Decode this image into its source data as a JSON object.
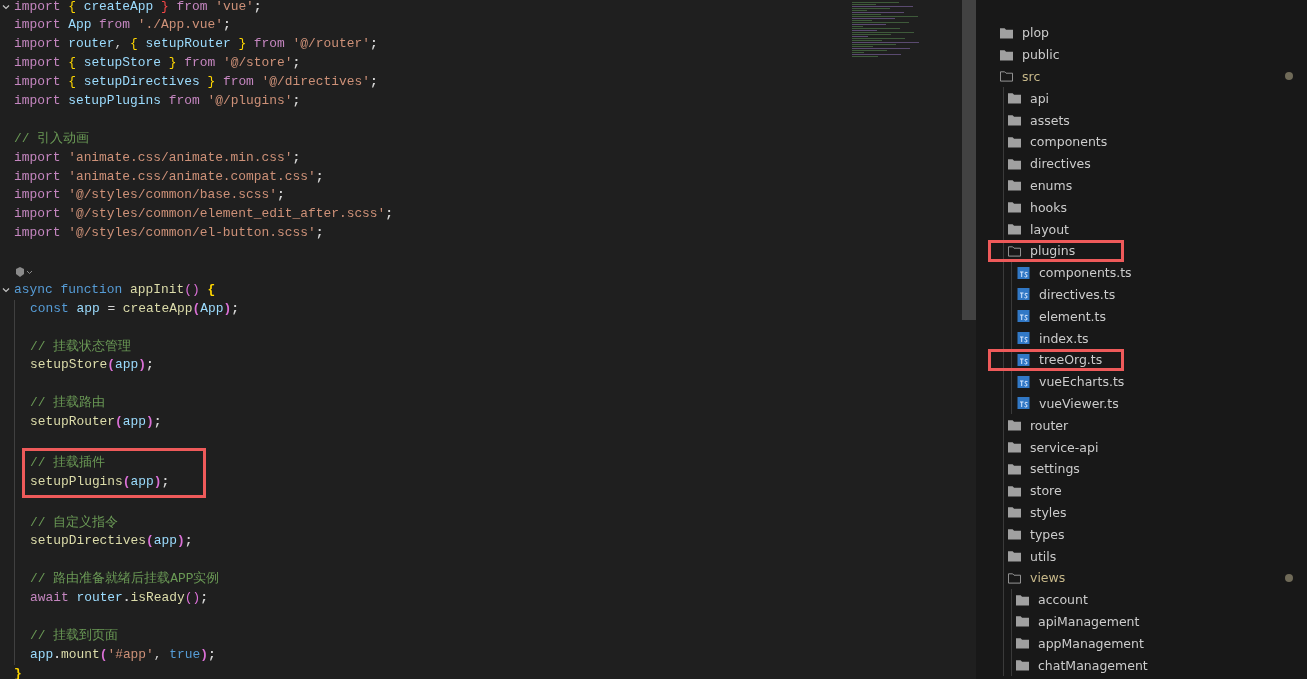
{
  "editor": {
    "lines": [
      {
        "kind": "code",
        "fold": true,
        "tokens": [
          {
            "t": "import ",
            "color": "#c586c0"
          },
          {
            "t": "{ ",
            "color": "#ffd700"
          },
          {
            "t": "createApp ",
            "color": "#9cdcfe"
          },
          {
            "t": "} ",
            "color": "#f44747"
          },
          {
            "t": "from ",
            "color": "#c586c0"
          },
          {
            "t": "'vue'",
            "color": "#ce9178"
          },
          {
            "t": ";"
          }
        ]
      },
      {
        "kind": "code",
        "tokens": [
          {
            "t": "import ",
            "color": "#c586c0"
          },
          {
            "t": "App ",
            "color": "#9cdcfe"
          },
          {
            "t": "from ",
            "color": "#c586c0"
          },
          {
            "t": "'./App.vue'",
            "color": "#ce9178"
          },
          {
            "t": ";"
          }
        ]
      },
      {
        "kind": "code",
        "tokens": [
          {
            "t": "import ",
            "color": "#c586c0"
          },
          {
            "t": "router",
            "color": "#9cdcfe"
          },
          {
            "t": ", "
          },
          {
            "t": "{ ",
            "color": "#ffd700"
          },
          {
            "t": "setupRouter ",
            "color": "#9cdcfe"
          },
          {
            "t": "} ",
            "color": "#ffd700"
          },
          {
            "t": "from ",
            "color": "#c586c0"
          },
          {
            "t": "'@/router'",
            "color": "#ce9178"
          },
          {
            "t": ";"
          }
        ]
      },
      {
        "kind": "code",
        "tokens": [
          {
            "t": "import ",
            "color": "#c586c0"
          },
          {
            "t": "{ ",
            "color": "#ffd700"
          },
          {
            "t": "setupStore ",
            "color": "#9cdcfe"
          },
          {
            "t": "} ",
            "color": "#ffd700"
          },
          {
            "t": "from ",
            "color": "#c586c0"
          },
          {
            "t": "'@/store'",
            "color": "#ce9178"
          },
          {
            "t": ";"
          }
        ]
      },
      {
        "kind": "code",
        "tokens": [
          {
            "t": "import ",
            "color": "#c586c0"
          },
          {
            "t": "{ ",
            "color": "#ffd700"
          },
          {
            "t": "setupDirectives ",
            "color": "#9cdcfe"
          },
          {
            "t": "} ",
            "color": "#ffd700"
          },
          {
            "t": "from ",
            "color": "#c586c0"
          },
          {
            "t": "'@/directives'",
            "color": "#ce9178"
          },
          {
            "t": ";"
          }
        ]
      },
      {
        "kind": "code",
        "tokens": [
          {
            "t": "import ",
            "color": "#c586c0"
          },
          {
            "t": "setupPlugins ",
            "color": "#9cdcfe"
          },
          {
            "t": "from ",
            "color": "#c586c0"
          },
          {
            "t": "'@/plugins'",
            "color": "#ce9178"
          },
          {
            "t": ";"
          }
        ]
      },
      {
        "kind": "blank"
      },
      {
        "kind": "code",
        "tokens": [
          {
            "t": "// 引入动画",
            "color": "#6a9955"
          }
        ]
      },
      {
        "kind": "code",
        "tokens": [
          {
            "t": "import ",
            "color": "#c586c0"
          },
          {
            "t": "'animate.css/animate.min.css'",
            "color": "#ce9178"
          },
          {
            "t": ";"
          }
        ]
      },
      {
        "kind": "code",
        "tokens": [
          {
            "t": "import ",
            "color": "#c586c0"
          },
          {
            "t": "'animate.css/animate.compat.css'",
            "color": "#ce9178"
          },
          {
            "t": ";"
          }
        ]
      },
      {
        "kind": "code",
        "tokens": [
          {
            "t": "import ",
            "color": "#c586c0"
          },
          {
            "t": "'@/styles/common/base.scss'",
            "color": "#ce9178"
          },
          {
            "t": ";"
          }
        ]
      },
      {
        "kind": "code",
        "tokens": [
          {
            "t": "import ",
            "color": "#c586c0"
          },
          {
            "t": "'@/styles/common/element_edit_after.scss'",
            "color": "#ce9178"
          },
          {
            "t": ";"
          }
        ]
      },
      {
        "kind": "code",
        "tokens": [
          {
            "t": "import ",
            "color": "#c586c0"
          },
          {
            "t": "'@/styles/common/el-button.scss'",
            "color": "#ce9178"
          },
          {
            "t": ";"
          }
        ]
      },
      {
        "kind": "blank"
      },
      {
        "kind": "codelens"
      },
      {
        "kind": "code",
        "fold": true,
        "tokens": [
          {
            "t": "async ",
            "color": "#569cd6"
          },
          {
            "t": "function ",
            "color": "#569cd6"
          },
          {
            "t": "appInit",
            "color": "#dcdcaa"
          },
          {
            "t": "() ",
            "color": "#da70d6"
          },
          {
            "t": "{",
            "color": "#ffd700"
          }
        ]
      },
      {
        "kind": "code",
        "indented": true,
        "tokens": [
          {
            "t": "const ",
            "color": "#569cd6"
          },
          {
            "t": "app ",
            "color": "#9cdcfe"
          },
          {
            "t": "= "
          },
          {
            "t": "createApp",
            "color": "#dcdcaa"
          },
          {
            "t": "(",
            "color": "#da70d6"
          },
          {
            "t": "App",
            "color": "#9cdcfe"
          },
          {
            "t": ")",
            "color": "#da70d6"
          },
          {
            "t": ";"
          }
        ]
      },
      {
        "kind": "blank",
        "indented": true
      },
      {
        "kind": "code",
        "indented": true,
        "tokens": [
          {
            "t": "// 挂载状态管理",
            "color": "#6a9955"
          }
        ]
      },
      {
        "kind": "code",
        "indented": true,
        "tokens": [
          {
            "t": "setupStore",
            "color": "#dcdcaa"
          },
          {
            "t": "(",
            "color": "#da70d6"
          },
          {
            "t": "app",
            "color": "#9cdcfe"
          },
          {
            "t": ")",
            "color": "#da70d6"
          },
          {
            "t": ";"
          }
        ]
      },
      {
        "kind": "blank",
        "indented": true
      },
      {
        "kind": "code",
        "indented": true,
        "tokens": [
          {
            "t": "// 挂载路由",
            "color": "#6a9955"
          }
        ]
      },
      {
        "kind": "code",
        "indented": true,
        "tokens": [
          {
            "t": "setupRouter",
            "color": "#dcdcaa"
          },
          {
            "t": "(",
            "color": "#da70d6"
          },
          {
            "t": "app",
            "color": "#9cdcfe"
          },
          {
            "t": ")",
            "color": "#da70d6"
          },
          {
            "t": ";"
          }
        ]
      },
      {
        "kind": "blank",
        "indented": true
      },
      {
        "kind": "code",
        "indented": true,
        "boxed": true,
        "tokens": [
          {
            "t": "// 挂载插件",
            "color": "#6a9955"
          }
        ]
      },
      {
        "kind": "code",
        "indented": true,
        "boxed": true,
        "tokens": [
          {
            "t": "setupPlugins",
            "color": "#dcdcaa"
          },
          {
            "t": "(",
            "color": "#da70d6"
          },
          {
            "t": "app",
            "color": "#9cdcfe"
          },
          {
            "t": ")",
            "color": "#da70d6"
          },
          {
            "t": ";"
          }
        ]
      },
      {
        "kind": "blank",
        "indented": true
      },
      {
        "kind": "code",
        "indented": true,
        "tokens": [
          {
            "t": "// 自定义指令",
            "color": "#6a9955"
          }
        ]
      },
      {
        "kind": "code",
        "indented": true,
        "tokens": [
          {
            "t": "setupDirectives",
            "color": "#dcdcaa"
          },
          {
            "t": "(",
            "color": "#da70d6"
          },
          {
            "t": "app",
            "color": "#9cdcfe"
          },
          {
            "t": ")",
            "color": "#da70d6"
          },
          {
            "t": ";"
          }
        ]
      },
      {
        "kind": "blank",
        "indented": true
      },
      {
        "kind": "code",
        "indented": true,
        "tokens": [
          {
            "t": "// 路由准备就绪后挂载APP实例",
            "color": "#6a9955"
          }
        ]
      },
      {
        "kind": "code",
        "indented": true,
        "tokens": [
          {
            "t": "await ",
            "color": "#c586c0"
          },
          {
            "t": "router",
            "color": "#9cdcfe"
          },
          {
            "t": "."
          },
          {
            "t": "isReady",
            "color": "#dcdcaa"
          },
          {
            "t": "()",
            "color": "#da70d6"
          },
          {
            "t": ";"
          }
        ]
      },
      {
        "kind": "blank",
        "indented": true
      },
      {
        "kind": "code",
        "indented": true,
        "tokens": [
          {
            "t": "// 挂载到页面",
            "color": "#6a9955"
          }
        ]
      },
      {
        "kind": "code",
        "indented": true,
        "tokens": [
          {
            "t": "app",
            "color": "#9cdcfe"
          },
          {
            "t": "."
          },
          {
            "t": "mount",
            "color": "#dcdcaa"
          },
          {
            "t": "(",
            "color": "#da70d6"
          },
          {
            "t": "'#app'",
            "color": "#ce9178"
          },
          {
            "t": ", "
          },
          {
            "t": "true",
            "color": "#569cd6"
          },
          {
            "t": ")",
            "color": "#da70d6"
          },
          {
            "t": ";"
          }
        ]
      },
      {
        "kind": "code",
        "tokens": [
          {
            "t": "}",
            "color": "#ffd700"
          }
        ]
      }
    ]
  },
  "explorer": {
    "tree": [
      {
        "name": "plop",
        "kind": "folder",
        "expanded": false
      },
      {
        "name": "public",
        "kind": "folder",
        "expanded": false
      },
      {
        "name": "src",
        "kind": "folder",
        "expanded": true,
        "modified": true,
        "children": [
          {
            "name": "api",
            "kind": "folder",
            "expanded": false
          },
          {
            "name": "assets",
            "kind": "folder",
            "expanded": false
          },
          {
            "name": "components",
            "kind": "folder",
            "expanded": false
          },
          {
            "name": "directives",
            "kind": "folder",
            "expanded": false
          },
          {
            "name": "enums",
            "kind": "folder",
            "expanded": false
          },
          {
            "name": "hooks",
            "kind": "folder",
            "expanded": false
          },
          {
            "name": "layout",
            "kind": "folder",
            "expanded": false
          },
          {
            "name": "plugins",
            "kind": "folder",
            "expanded": true,
            "boxed": true,
            "children": [
              {
                "name": "components.ts",
                "kind": "ts"
              },
              {
                "name": "directives.ts",
                "kind": "ts"
              },
              {
                "name": "element.ts",
                "kind": "ts"
              },
              {
                "name": "index.ts",
                "kind": "ts"
              },
              {
                "name": "treeOrg.ts",
                "kind": "ts",
                "boxed": true
              },
              {
                "name": "vueEcharts.ts",
                "kind": "ts"
              },
              {
                "name": "vueViewer.ts",
                "kind": "ts"
              }
            ]
          },
          {
            "name": "router",
            "kind": "folder",
            "expanded": false
          },
          {
            "name": "service-api",
            "kind": "folder",
            "expanded": false
          },
          {
            "name": "settings",
            "kind": "folder",
            "expanded": false
          },
          {
            "name": "store",
            "kind": "folder",
            "expanded": false
          },
          {
            "name": "styles",
            "kind": "folder",
            "expanded": false
          },
          {
            "name": "types",
            "kind": "folder",
            "expanded": false
          },
          {
            "name": "utils",
            "kind": "folder",
            "expanded": false
          },
          {
            "name": "views",
            "kind": "folder",
            "expanded": true,
            "modified": true,
            "children": [
              {
                "name": "account",
                "kind": "folder",
                "expanded": false
              },
              {
                "name": "apiManagement",
                "kind": "folder",
                "expanded": false
              },
              {
                "name": "appManagement",
                "kind": "folder",
                "expanded": false
              },
              {
                "name": "chatManagement",
                "kind": "folder",
                "expanded": false
              }
            ]
          }
        ]
      }
    ]
  }
}
